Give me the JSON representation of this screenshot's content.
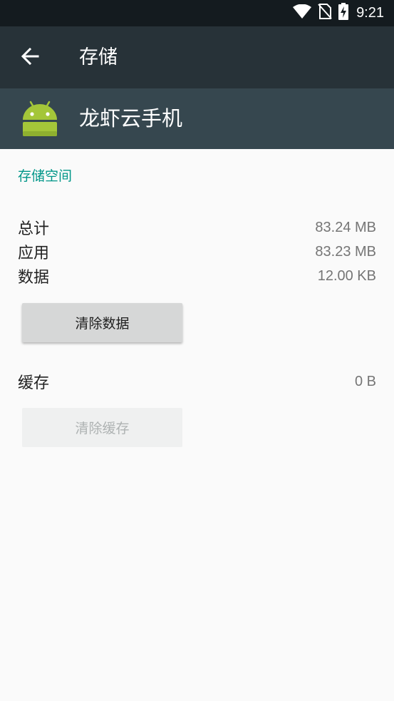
{
  "status_bar": {
    "time": "9:21",
    "icons": [
      "wifi-icon",
      "no-sim-icon",
      "battery-charging-icon"
    ]
  },
  "toolbar": {
    "back_icon": "arrow-left-icon",
    "title": "存储"
  },
  "app": {
    "icon": "android-robot-icon",
    "name": "龙虾云手机"
  },
  "storage": {
    "section_title": "存储空间",
    "rows": [
      {
        "label": "总计",
        "value": "83.24 MB"
      },
      {
        "label": "应用",
        "value": "83.23 MB"
      },
      {
        "label": "数据",
        "value": "12.00 KB"
      }
    ],
    "clear_data_label": "清除数据"
  },
  "cache": {
    "label": "缓存",
    "value": "0 B",
    "clear_cache_label": "清除缓存"
  },
  "colors": {
    "status_bar": "#141b1f",
    "toolbar": "#273238",
    "app_header": "#36474f",
    "accent": "#009688",
    "android_green": "#a4c639"
  }
}
